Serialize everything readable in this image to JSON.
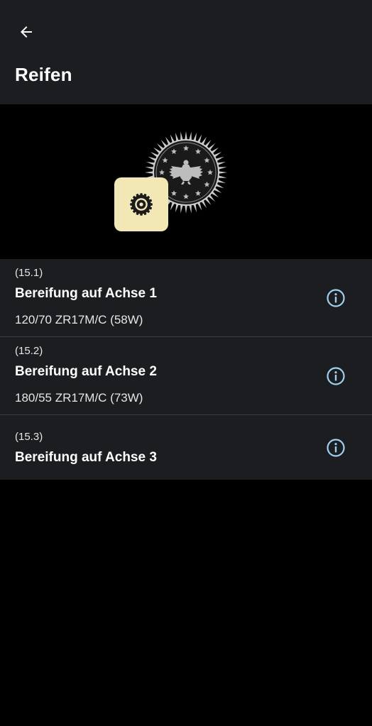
{
  "header": {
    "title": "Reifen",
    "back_icon": "arrow-back-icon"
  },
  "hero": {
    "seal_icon": "federal-eagle-seal-icon",
    "tile_icon": "tire-icon",
    "tile_color": "#f1e8b6"
  },
  "items": [
    {
      "code": "(15.1)",
      "label": "Bereifung auf Achse 1",
      "value": "120/70 ZR17M/C (58W)",
      "icon": "info-icon"
    },
    {
      "code": "(15.2)",
      "label": "Bereifung auf Achse 2",
      "value": "180/55 ZR17M/C (73W)",
      "icon": "info-icon"
    },
    {
      "code": "(15.3)",
      "label": "Bereifung auf Achse 3",
      "value": "",
      "icon": "info-icon"
    }
  ],
  "colors": {
    "surface": "#1b1d20",
    "background": "#000000",
    "info_accent": "#9fd0ef"
  }
}
